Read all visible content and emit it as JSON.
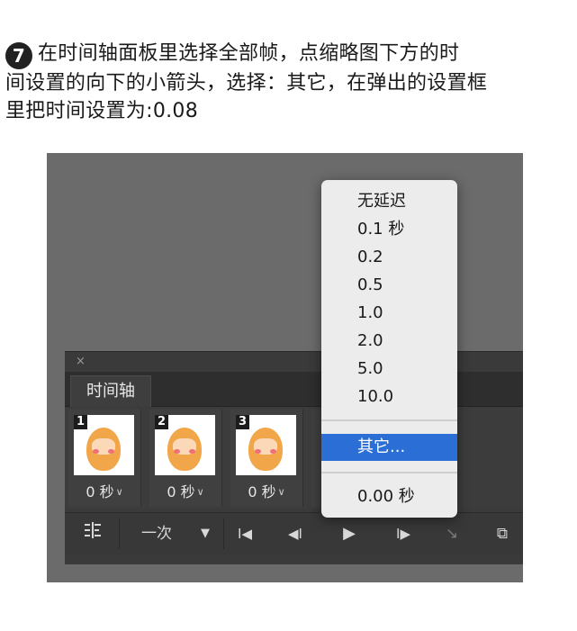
{
  "instruction": {
    "step_number": "7",
    "line1": "在时间轴面板里选择全部帧，点缩略图下方的时",
    "line2": "间设置的向下的小箭头，选择：其它，在弹出的设置框",
    "line3": "里把时间设置为:0.08"
  },
  "panel": {
    "close_label": "×",
    "tab_label": "时间轴",
    "frames": [
      {
        "number": "1",
        "time": "0 秒"
      },
      {
        "number": "2",
        "time": "0 秒"
      },
      {
        "number": "3",
        "time": "0 秒"
      }
    ],
    "time_chevron": "∨"
  },
  "toolbar": {
    "convert_icon": "convert-icon",
    "loop_label": "一次",
    "loop_arrow": "▼",
    "first_frame": "I◀",
    "prev_frame": "◀I",
    "play": "▶",
    "next_frame": "I▶",
    "tween": "↘",
    "new_frame": "⧉"
  },
  "menu": {
    "items": [
      "无延迟",
      "0.1 秒",
      "0.2",
      "0.5",
      "1.0",
      "2.0",
      "5.0",
      "10.0"
    ],
    "other": "其它...",
    "current": "0.00 秒"
  }
}
